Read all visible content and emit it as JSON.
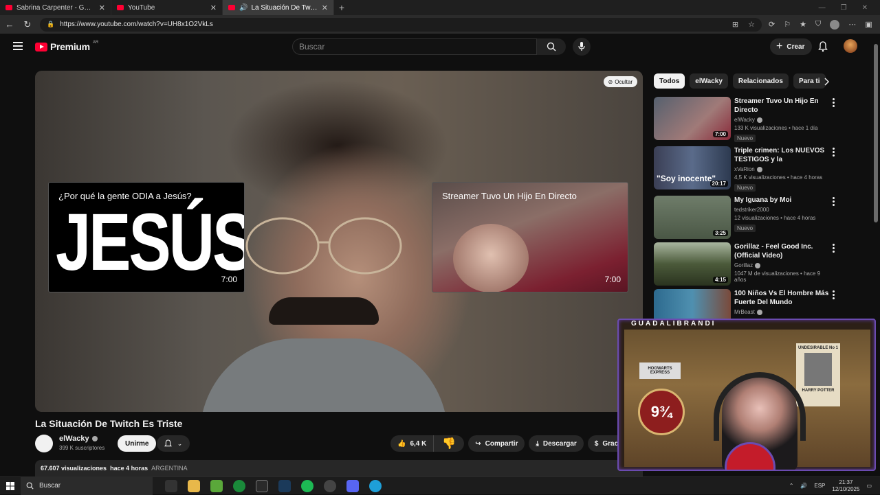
{
  "browser": {
    "tabs": [
      {
        "title": "Sabrina Carpenter - Go Go Juice (",
        "active": false
      },
      {
        "title": "YouTube",
        "active": false
      },
      {
        "title": "La Situación De Twitch Es Triste",
        "active": true
      }
    ],
    "url": "https://www.youtube.com/watch?v=UH8x1O2VkLs"
  },
  "header": {
    "logo_text": "Premium",
    "country": "AR",
    "search_placeholder": "Buscar",
    "create_label": "Crear"
  },
  "player": {
    "hide_label": "Ocultar",
    "endcards": [
      {
        "title": "¿Por qué la gente ODIA a Jesús?",
        "big_text": "JESÚS",
        "duration": "7:00"
      },
      {
        "title": "Streamer Tuvo Un Hijo En Directo",
        "duration": "7:00"
      }
    ]
  },
  "video": {
    "title": "La Situación De Twitch Es Triste",
    "channel": "elWacky",
    "subscribers": "399 K suscriptores",
    "join_label": "Unirme",
    "likes": "6,4 K",
    "share_label": "Compartir",
    "download_label": "Descargar",
    "thanks_label": "Gracias",
    "views": "67.607 visualizaciones",
    "posted": "hace 4 horas",
    "location": "ARGENTINA"
  },
  "chips": [
    "Todos",
    "elWacky",
    "Relacionados",
    "Para ti"
  ],
  "recommendations": [
    {
      "title": "Streamer Tuvo Un Hijo En Directo",
      "channel": "elWacky",
      "verified": true,
      "meta": "133 K visualizaciones • hace 1 día",
      "badge": "Nuevo",
      "duration": "7:00",
      "thumb": "#7a5a5a"
    },
    {
      "title": "Triple crimen: Los NUEVOS TESTIGOS y la DECLARACION ...",
      "channel": "xVaRion",
      "verified": true,
      "meta": "4,5 K visualizaciones • hace 4 horas",
      "badge": "Nuevo",
      "duration": "20:17",
      "thumb": "#3a4a6a",
      "overlay_text": "\"Soy inocente\""
    },
    {
      "title": "My Iguana by Moi",
      "channel": "tedstriker2000",
      "verified": false,
      "meta": "12 visualizaciones • hace 4 horas",
      "badge": "Nuevo",
      "duration": "3:25",
      "thumb": "#4f5e4a"
    },
    {
      "title": "Gorillaz - Feel Good Inc. (Official Video)",
      "channel": "Gorillaz",
      "verified": true,
      "meta": "1047 M de visualizaciones • hace 9 años",
      "badge": "",
      "duration": "4:15",
      "thumb": "#35432c"
    },
    {
      "title": "100 Niños Vs El Hombre Más Fuerte Del Mundo",
      "channel": "MrBeast",
      "verified": true,
      "meta": "",
      "badge": "",
      "duration": "",
      "thumb": "#2a5a7a"
    }
  ],
  "overlay": {
    "name": "GUADALIBRANDI",
    "platform_sign": "9¾",
    "hogwarts_sign": "HOGWARTS EXPRESS",
    "poster_title": "UNDESIRABLE No 1",
    "poster_name": "HARRY POTTER"
  },
  "taskbar": {
    "search_label": "Buscar",
    "language": "ESP",
    "time": "21:37",
    "date": "12/10/2025"
  },
  "colors": {
    "brand_red": "#ff0033",
    "background": "#0f0f0f",
    "chip_bg": "#272727",
    "overlay_border": "#6b4bb0"
  }
}
